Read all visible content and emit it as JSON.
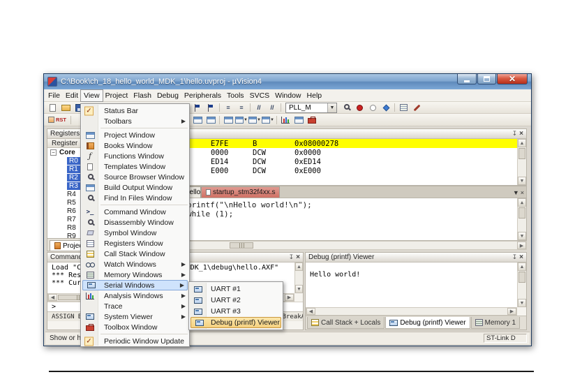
{
  "window": {
    "title": "C:\\Book\\ch_18_hello_world_MDK_1\\hello.uvproj - µVision4"
  },
  "menubar": {
    "items": [
      "File",
      "Edit",
      "View",
      "Project",
      "Flash",
      "Debug",
      "Peripherals",
      "Tools",
      "SVCS",
      "Window",
      "Help"
    ],
    "open_item": "View"
  },
  "toolbar": {
    "combo_value": "PLL_M",
    "rst_label": "RST"
  },
  "view_menu": {
    "items": [
      {
        "label": "Status Bar",
        "icon": "check-icon",
        "checked": true
      },
      {
        "label": "Toolbars",
        "submenu": true
      },
      {
        "label": "Project Window",
        "icon": "project-window-icon"
      },
      {
        "label": "Books Window",
        "icon": "books-window-icon"
      },
      {
        "label": "Functions Window",
        "icon": "functions-window-icon"
      },
      {
        "label": "Templates Window",
        "icon": "templates-window-icon"
      },
      {
        "label": "Source Browser Window",
        "icon": "source-browser-icon"
      },
      {
        "label": "Build Output Window",
        "icon": "build-output-window-icon"
      },
      {
        "label": "Find In Files Window",
        "icon": "find-in-files-icon"
      },
      {
        "label": "Command Window",
        "icon": "command-window-icon"
      },
      {
        "label": "Disassembly Window",
        "icon": "disassembly-window-icon"
      },
      {
        "label": "Symbol Window",
        "icon": "symbol-window-icon"
      },
      {
        "label": "Registers Window",
        "icon": "registers-window-icon"
      },
      {
        "label": "Call Stack Window",
        "icon": "call-stack-window-icon"
      },
      {
        "label": "Watch Windows",
        "icon": "watch-windows-icon",
        "submenu": true
      },
      {
        "label": "Memory Windows",
        "icon": "memory-windows-icon",
        "submenu": true
      },
      {
        "label": "Serial Windows",
        "icon": "serial-windows-icon",
        "submenu": true,
        "highlighted": true
      },
      {
        "label": "Analysis Windows",
        "icon": "analysis-windows-icon",
        "submenu": true
      },
      {
        "label": "Trace",
        "submenu": true
      },
      {
        "label": "System Viewer",
        "icon": "system-viewer-icon",
        "submenu": true
      },
      {
        "label": "Toolbox Window",
        "icon": "toolbox-window-icon"
      },
      {
        "label": "Periodic Window Update",
        "icon": "check-icon",
        "checked": true
      }
    ]
  },
  "serial_submenu": {
    "items": [
      {
        "label": "UART #1",
        "icon": "uart-icon"
      },
      {
        "label": "UART #2",
        "icon": "uart-icon"
      },
      {
        "label": "UART #3",
        "icon": "uart-icon"
      },
      {
        "label": "Debug (printf) Viewer",
        "icon": "printf-viewer-icon",
        "highlighted": true
      }
    ]
  },
  "registers_panel": {
    "title": "Registers",
    "column_header": "Register",
    "tree_root": "Core",
    "registers": [
      "R0",
      "R1",
      "R2",
      "R3",
      "R4",
      "R5",
      "R6",
      "R7",
      "R8",
      "R9"
    ],
    "bottom_tab": "Project"
  },
  "disassembly": {
    "rows": [
      {
        "opcode": "E7FE",
        "mnemonic": "B",
        "operand": "0x08000278",
        "current": true
      },
      {
        "opcode": "0000",
        "mnemonic": "DCW",
        "operand": "0x0000"
      },
      {
        "opcode": "ED14",
        "mnemonic": "DCW",
        "operand": "0xED14"
      },
      {
        "opcode": "E000",
        "mnemonic": "DCW",
        "operand": "0xE000"
      }
    ]
  },
  "editor": {
    "tabs": [
      {
        "label": "hello.c"
      },
      {
        "label": "startup_stm32f4xx.s",
        "active": true
      }
    ],
    "lines": [
      "printf(\"\\nHello world!\\n\");",
      "while (1);"
    ]
  },
  "command_panel": {
    "title": "Command",
    "output_lines": [
      "Load \"C:\\Book\\ch_18_hello_world_MDK_1\\debug\\hello.AXF\"",
      "*** Restr",
      "*** Curre"
    ],
    "prompt": ">",
    "help_line": "ASSIGN BreakDisable BreakEnable BreakKill BreakList BreakSet BreakAccess"
  },
  "printf_viewer": {
    "title": "Debug (printf) Viewer",
    "content": "Hello world!"
  },
  "dock_tabs": {
    "items": [
      {
        "label": "Call Stack + Locals",
        "icon": "call-stack-tab-icon"
      },
      {
        "label": "Debug (printf) Viewer",
        "icon": "printf-viewer-tab-icon",
        "active": true
      },
      {
        "label": "Memory 1",
        "icon": "memory-tab-icon"
      }
    ]
  },
  "statusbar": {
    "left": "Show or hid",
    "right": "ST-Link D"
  }
}
